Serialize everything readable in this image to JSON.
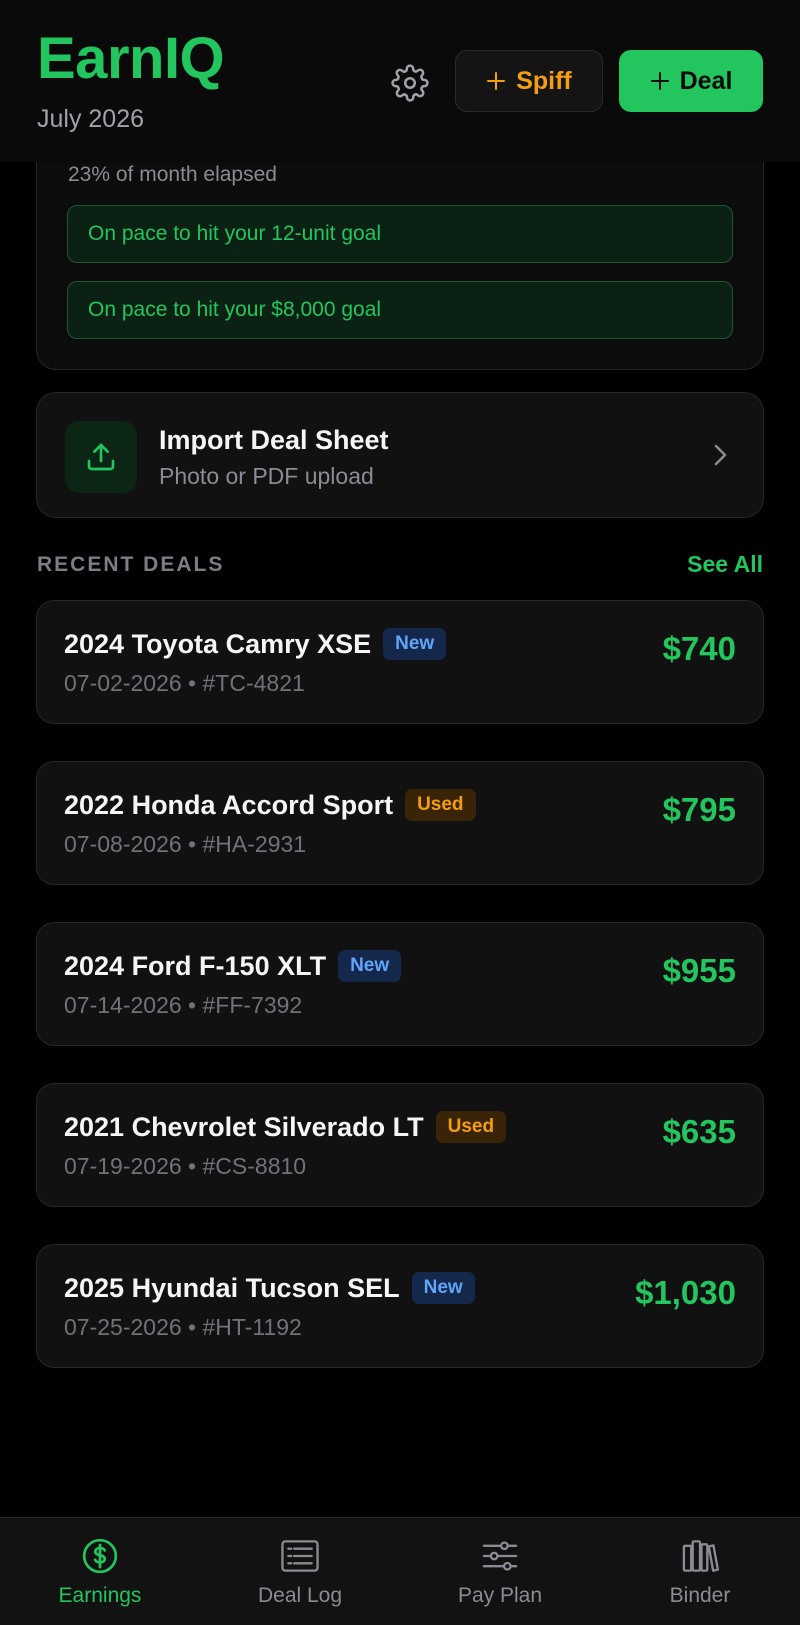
{
  "header": {
    "app_title": "EarnIQ",
    "month": "July 2026",
    "spiff_label": "Spiff",
    "deal_label": "Deal",
    "icons": {
      "settings": "gear-icon",
      "spiff": "plus-icon",
      "deal": "plus-icon"
    }
  },
  "pace": {
    "elapsed_text": "23% of month elapsed",
    "goals": [
      "On pace to hit your 12-unit goal",
      "On pace to hit your $8,000 goal"
    ]
  },
  "import": {
    "title": "Import Deal Sheet",
    "subtitle": "Photo or PDF upload",
    "icon": "upload-icon"
  },
  "recent": {
    "section_label": "RECENT DEALS",
    "see_all_label": "See All",
    "deals": [
      {
        "title": "2024 Toyota Camry XSE",
        "badge": "New",
        "badge_type": "new",
        "date": "07-02-2026",
        "stock": "#TC-4821",
        "amount": "$740"
      },
      {
        "title": "2022 Honda Accord Sport",
        "badge": "Used",
        "badge_type": "used",
        "date": "07-08-2026",
        "stock": "#HA-2931",
        "amount": "$795"
      },
      {
        "title": "2024 Ford F-150 XLT",
        "badge": "New",
        "badge_type": "new",
        "date": "07-14-2026",
        "stock": "#FF-7392",
        "amount": "$955"
      },
      {
        "title": "2021 Chevrolet Silverado LT",
        "badge": "Used",
        "badge_type": "used",
        "date": "07-19-2026",
        "stock": "#CS-8810",
        "amount": "$635"
      },
      {
        "title": "2025 Hyundai Tucson SEL",
        "badge": "New",
        "badge_type": "new",
        "date": "07-25-2026",
        "stock": "#HT-1192",
        "amount": "$1,030"
      }
    ]
  },
  "tabs": [
    {
      "label": "Earnings",
      "icon": "dollar-circle-icon",
      "active": true
    },
    {
      "label": "Deal Log",
      "icon": "list-icon",
      "active": false
    },
    {
      "label": "Pay Plan",
      "icon": "sliders-icon",
      "active": false
    },
    {
      "label": "Binder",
      "icon": "books-icon",
      "active": false
    }
  ],
  "colors": {
    "accent_green": "#22c55e",
    "spiff_orange": "#f59e0b",
    "new_badge": "#60a5fa",
    "used_badge": "#f59e0b",
    "background": "#000000",
    "card": "#111111"
  }
}
